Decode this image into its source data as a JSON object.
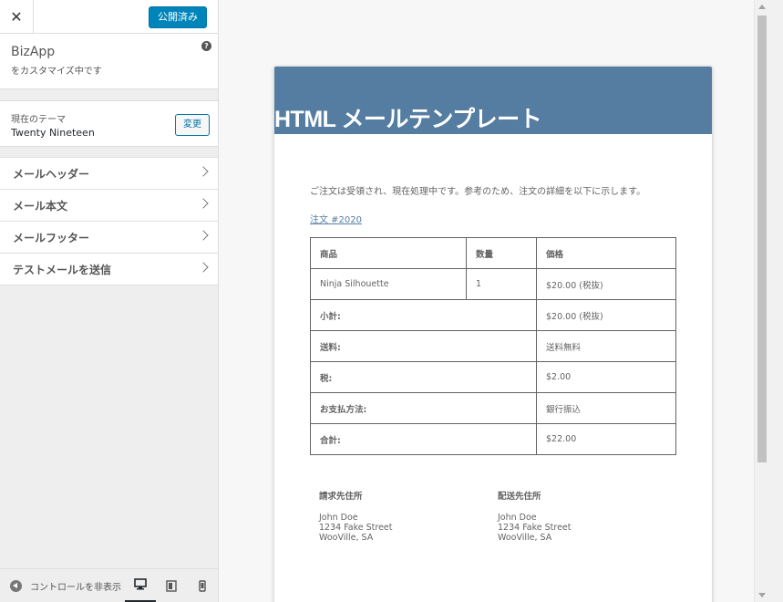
{
  "header": {
    "close_symbol": "✕",
    "publish_label": "公開済み"
  },
  "site": {
    "title": "BizApp",
    "subtitle": "をカスタマイズ中です",
    "help_symbol": "?"
  },
  "theme": {
    "label": "現在のテーマ",
    "name": "Twenty Nineteen",
    "change_label": "変更"
  },
  "menu": {
    "items": [
      {
        "label": "メールヘッダー"
      },
      {
        "label": "メール本文"
      },
      {
        "label": "メールフッター"
      },
      {
        "label": "テストメールを送信"
      }
    ]
  },
  "footer": {
    "collapse_label": "コントロールを非表示"
  },
  "email": {
    "header_color": "#557da1",
    "title": "HTML メールテンプレート",
    "intro": "ご注文は受領され、現在処理中です。参考のため、注文の詳細を以下に示します。",
    "order_link": "注文 #2020",
    "table": {
      "headers": [
        "商品",
        "数量",
        "価格"
      ],
      "item": {
        "name": "Ninja Silhouette",
        "qty": "1",
        "price": "$20.00 (税抜)"
      },
      "totals": [
        {
          "label": "小計:",
          "value": "$20.00 (税抜)"
        },
        {
          "label": "送料:",
          "value": "送料無料"
        },
        {
          "label": "税:",
          "value": "$2.00"
        },
        {
          "label": "お支払方法:",
          "value": "銀行振込"
        },
        {
          "label": "合計:",
          "value": "$22.00"
        }
      ]
    },
    "billing": {
      "title": "請求先住所",
      "line1": "John Doe",
      "line2": "1234 Fake Street",
      "line3": "WooVille, SA"
    },
    "shipping": {
      "title": "配送先住所",
      "line1": "John Doe",
      "line2": "1234 Fake Street",
      "line3": "WooVille, SA"
    }
  }
}
